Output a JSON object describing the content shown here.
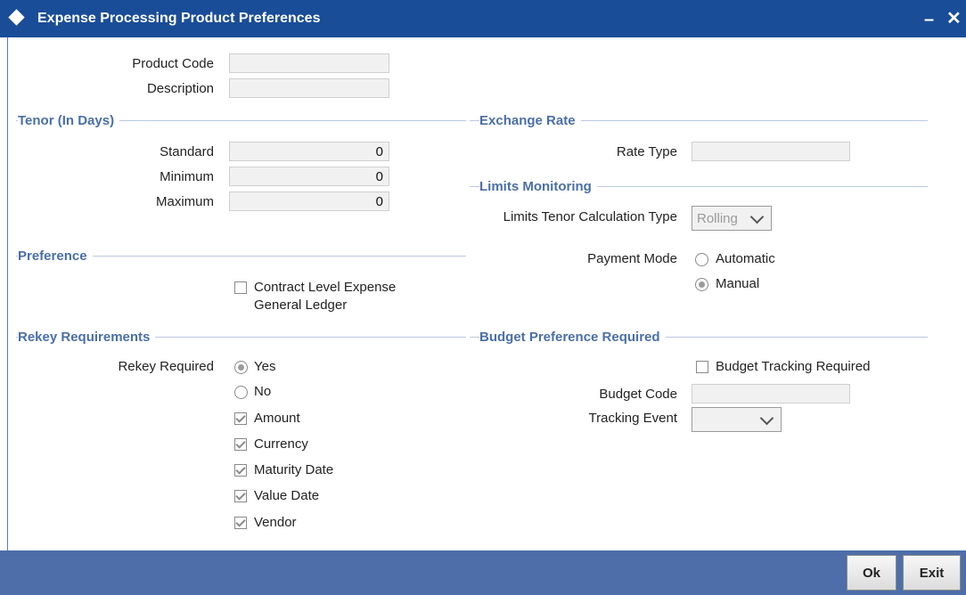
{
  "window": {
    "title": "Expense Processing Product Preferences",
    "minimize_glyph": "–",
    "close_glyph": "✕"
  },
  "product": {
    "code_label": "Product Code",
    "code_value": "",
    "description_label": "Description",
    "description_value": ""
  },
  "tenor": {
    "heading": "Tenor (In Days)",
    "standard_label": "Standard",
    "standard_value": "0",
    "minimum_label": "Minimum",
    "minimum_value": "0",
    "maximum_label": "Maximum",
    "maximum_value": "0"
  },
  "exchange_rate": {
    "heading": "Exchange Rate",
    "rate_type_label": "Rate Type",
    "rate_type_value": ""
  },
  "limits": {
    "heading": "Limits Monitoring",
    "tenor_calc_label": "Limits Tenor Calculation Type",
    "tenor_calc_value": "Rolling",
    "payment_mode_label": "Payment Mode",
    "payment_modes": [
      {
        "label": "Automatic",
        "selected": false
      },
      {
        "label": "Manual",
        "selected": true
      }
    ]
  },
  "preference": {
    "heading": "Preference",
    "contract_gl_label_line1": "Contract Level Expense",
    "contract_gl_label_line2": "General Ledger",
    "contract_gl_checked": false
  },
  "rekey": {
    "heading": "Rekey Requirements",
    "required_label": "Rekey Required",
    "yes_label": "Yes",
    "no_label": "No",
    "selected": "Yes",
    "fields": [
      {
        "label": "Amount",
        "checked": true
      },
      {
        "label": "Currency",
        "checked": true
      },
      {
        "label": "Maturity Date",
        "checked": true
      },
      {
        "label": "Value Date",
        "checked": true
      },
      {
        "label": "Vendor",
        "checked": true
      }
    ]
  },
  "budget": {
    "heading": "Budget Preference Required",
    "tracking_required_label": "Budget Tracking Required",
    "tracking_required_checked": false,
    "code_label": "Budget Code",
    "code_value": "",
    "tracking_event_label": "Tracking Event",
    "tracking_event_value": ""
  },
  "footer": {
    "ok_label": "Ok",
    "exit_label": "Exit"
  },
  "colors": {
    "titlebar": "#1a4d97",
    "footer": "#4d6ea8",
    "section_heading": "#4a6fa8"
  },
  "icons": {
    "title": "diamond-icon",
    "minimize": "minimize-icon",
    "close": "close-icon",
    "dropdown": "chevron-down-icon"
  }
}
